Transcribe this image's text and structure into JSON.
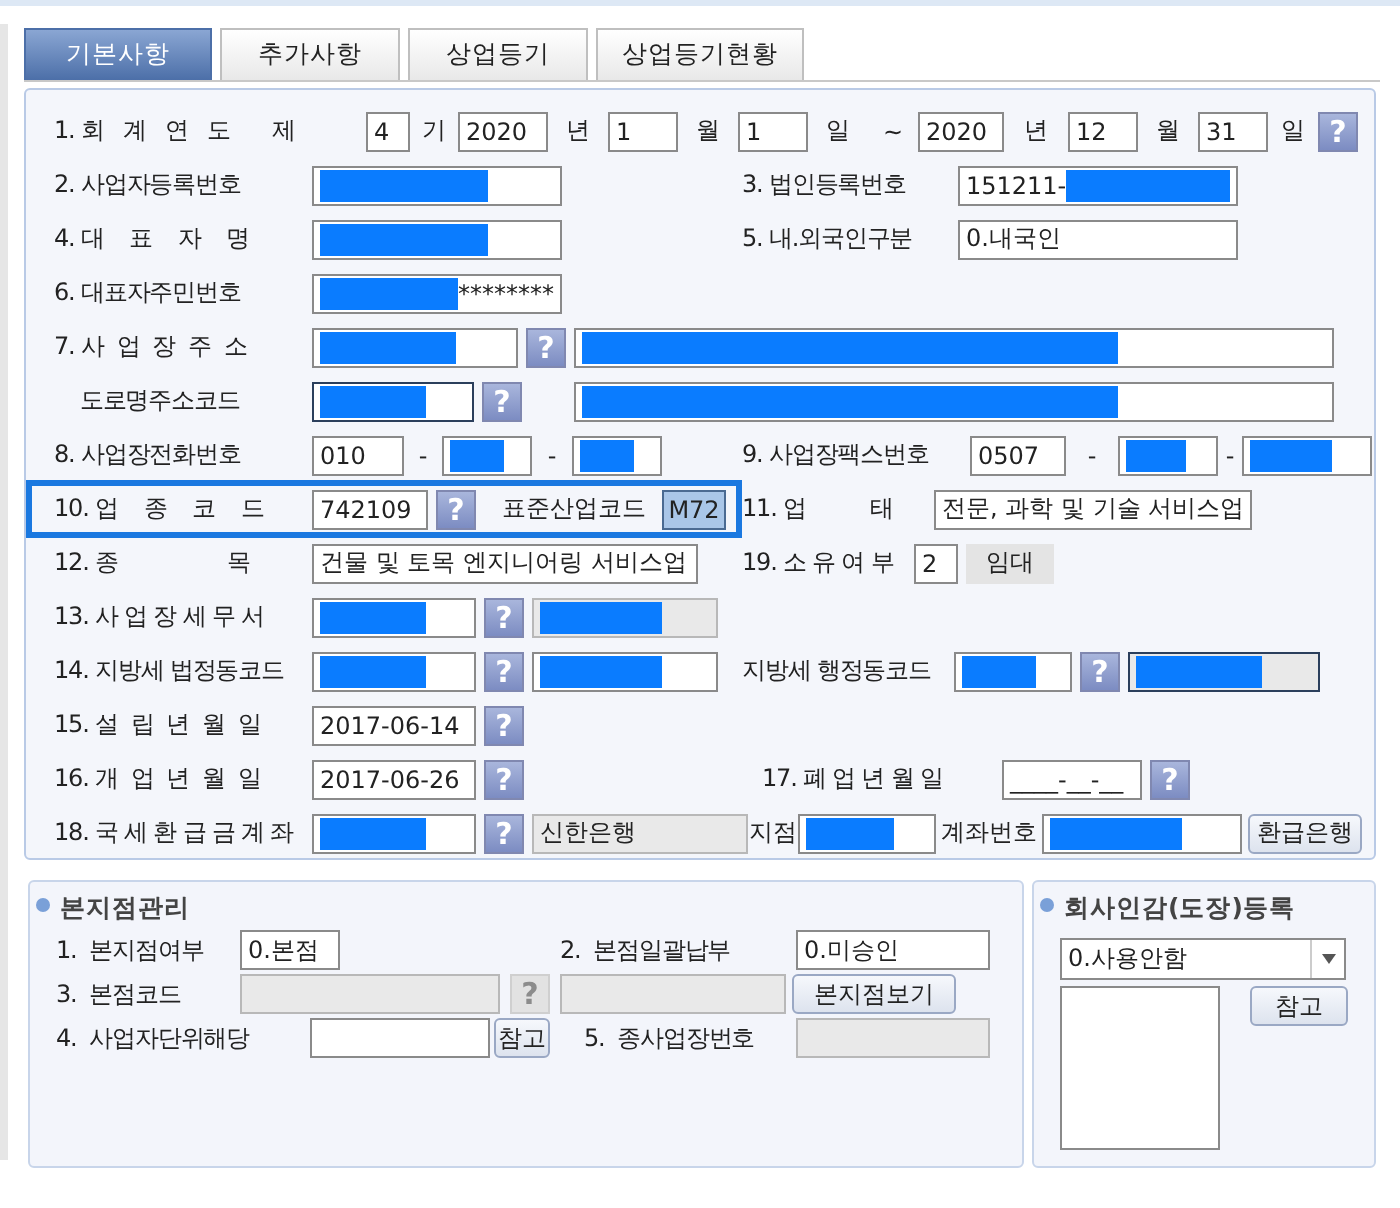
{
  "tabs": [
    {
      "label": "기본사항",
      "selected": true
    },
    {
      "label": "추가사항",
      "selected": false
    },
    {
      "label": "상업등기",
      "selected": false
    },
    {
      "label": "상업등기현황",
      "selected": false
    }
  ],
  "form": {
    "rows": [
      {
        "highlighted": false,
        "left": [
          {
            "kind": "label",
            "text": "1. 회   계   연   도"
          },
          {
            "kind": "text",
            "text": "제"
          },
          {
            "kind": "field",
            "value": "4",
            "redacted": false,
            "disabled": false,
            "focused": false
          },
          {
            "kind": "text",
            "text": "기"
          },
          {
            "kind": "field",
            "value": "2020",
            "redacted": false,
            "disabled": false,
            "focused": false
          },
          {
            "kind": "text",
            "text": "년"
          },
          {
            "kind": "field",
            "value": "1",
            "redacted": false,
            "disabled": false,
            "focused": false
          },
          {
            "kind": "text",
            "text": "월"
          },
          {
            "kind": "field",
            "value": "1",
            "redacted": false,
            "disabled": false,
            "focused": false
          },
          {
            "kind": "text",
            "text": "일"
          },
          {
            "kind": "text",
            "text": "~"
          },
          {
            "kind": "field",
            "value": "2020",
            "redacted": false,
            "disabled": false,
            "focused": false
          },
          {
            "kind": "text",
            "text": "년"
          },
          {
            "kind": "field",
            "value": "12",
            "redacted": false,
            "disabled": false,
            "focused": false
          },
          {
            "kind": "text",
            "text": "월"
          },
          {
            "kind": "field",
            "value": "31",
            "redacted": false,
            "disabled": false,
            "focused": false
          },
          {
            "kind": "text",
            "text": "일"
          },
          {
            "kind": "help",
            "text": "?",
            "disabled": false
          }
        ]
      },
      {
        "highlighted": false,
        "left": [
          {
            "kind": "label",
            "text": "2. 사업자등록번호"
          },
          {
            "kind": "field",
            "redacted": true,
            "disabled": false,
            "focused": false
          }
        ],
        "right": [
          {
            "kind": "label",
            "text": "3. 법인등록번호"
          },
          {
            "kind": "field",
            "value": "151211-",
            "redacted": true,
            "disabled": false,
            "focused": false
          }
        ]
      },
      {
        "highlighted": false,
        "left": [
          {
            "kind": "label",
            "text": "4. 대    표    자    명"
          },
          {
            "kind": "field",
            "redacted": true,
            "disabled": false,
            "focused": false
          }
        ],
        "right": [
          {
            "kind": "label",
            "text": "5. 내.외국인구분"
          },
          {
            "kind": "field",
            "value": "0.내국인",
            "redacted": false,
            "disabled": false,
            "focused": false
          }
        ]
      },
      {
        "highlighted": false,
        "left": [
          {
            "kind": "label",
            "text": "6. 대표자주민번호"
          },
          {
            "kind": "field",
            "redacted": true,
            "after": "********",
            "disabled": false,
            "focused": false
          }
        ]
      },
      {
        "highlighted": false,
        "left": [
          {
            "kind": "label",
            "text": "7. 사  업  장  주  소"
          },
          {
            "kind": "field",
            "redacted": true,
            "disabled": false,
            "focused": false
          },
          {
            "kind": "help",
            "text": "?",
            "disabled": false
          },
          {
            "kind": "field",
            "redacted": true,
            "disabled": false,
            "focused": false
          }
        ]
      },
      {
        "highlighted": false,
        "left": [
          {
            "kind": "label",
            "text": "    도로명주소코드"
          },
          {
            "kind": "field",
            "redacted": true,
            "disabled": false,
            "focused": true
          },
          {
            "kind": "help",
            "text": "?",
            "disabled": false
          },
          {
            "kind": "field",
            "redacted": true,
            "disabled": false,
            "focused": false
          }
        ]
      },
      {
        "highlighted": false,
        "left": [
          {
            "kind": "label",
            "text": "8. 사업장전화번호"
          },
          {
            "kind": "field",
            "value": "010",
            "redacted": false,
            "disabled": false,
            "focused": false
          },
          {
            "kind": "text",
            "text": "-"
          },
          {
            "kind": "field",
            "redacted": true,
            "disabled": false,
            "focused": false
          },
          {
            "kind": "text",
            "text": "-"
          },
          {
            "kind": "field",
            "redacted": true,
            "disabled": false,
            "focused": false
          }
        ],
        "right": [
          {
            "kind": "label",
            "text": "9. 사업장팩스번호"
          },
          {
            "kind": "field",
            "value": "0507",
            "redacted": false,
            "disabled": false,
            "focused": false
          },
          {
            "kind": "text",
            "text": "-"
          },
          {
            "kind": "field",
            "redacted": true,
            "disabled": false,
            "focused": false
          },
          {
            "kind": "text",
            "text": "-"
          },
          {
            "kind": "field",
            "redacted": true,
            "disabled": false,
            "focused": false
          }
        ]
      },
      {
        "highlighted": true,
        "left": [
          {
            "kind": "label",
            "text": "10. 업    종    코    드"
          },
          {
            "kind": "field",
            "value": "742109",
            "redacted": false,
            "disabled": false,
            "focused": false
          },
          {
            "kind": "help",
            "text": "?",
            "disabled": false
          },
          {
            "kind": "text",
            "text": "표준산업코드"
          },
          {
            "kind": "code",
            "text": "M72"
          }
        ],
        "right": [
          {
            "kind": "label",
            "text": "11. 업          태"
          },
          {
            "kind": "field",
            "value": "전문, 과학 및 기술 서비스업",
            "redacted": false,
            "disabled": false,
            "focused": false
          }
        ]
      },
      {
        "highlighted": false,
        "left": [
          {
            "kind": "label",
            "text": "12. 종                 목"
          },
          {
            "kind": "field",
            "value": "건물 및 토목 엔지니어링 서비스업",
            "redacted": false,
            "disabled": false,
            "focused": false
          }
        ],
        "right": [
          {
            "kind": "label",
            "text": "19. 소 유 여 부"
          },
          {
            "kind": "field",
            "value": "2",
            "redacted": false,
            "disabled": false,
            "focused": false
          },
          {
            "kind": "display",
            "text": "임대"
          }
        ]
      },
      {
        "highlighted": false,
        "left": [
          {
            "kind": "label",
            "text": "13. 사 업 장 세 무 서"
          },
          {
            "kind": "field",
            "redacted": true,
            "disabled": false,
            "focused": false
          },
          {
            "kind": "help",
            "text": "?",
            "disabled": false
          },
          {
            "kind": "field",
            "redacted": true,
            "disabled": true,
            "focused": false
          }
        ]
      },
      {
        "highlighted": false,
        "left": [
          {
            "kind": "label",
            "text": "14. 지방세 법정동코드"
          },
          {
            "kind": "field",
            "redacted": true,
            "disabled": false,
            "focused": false
          },
          {
            "kind": "help",
            "text": "?",
            "disabled": false
          },
          {
            "kind": "field",
            "redacted": true,
            "disabled": false,
            "focused": false
          }
        ],
        "right": [
          {
            "kind": "label",
            "text": "지방세 행정동코드"
          },
          {
            "kind": "field",
            "redacted": true,
            "disabled": false,
            "focused": false
          },
          {
            "kind": "help",
            "text": "?",
            "disabled": false
          },
          {
            "kind": "field",
            "redacted": true,
            "disabled": true,
            "focused": true
          }
        ]
      },
      {
        "highlighted": false,
        "left": [
          {
            "kind": "label",
            "text": "15. 설  립  년  월  일"
          },
          {
            "kind": "field",
            "value": "2017-06-14",
            "redacted": false,
            "disabled": false,
            "focused": false
          },
          {
            "kind": "help",
            "text": "?",
            "disabled": false
          }
        ]
      },
      {
        "highlighted": false,
        "left": [
          {
            "kind": "label",
            "text": "16. 개  업  년  월  일"
          },
          {
            "kind": "field",
            "value": "2017-06-26",
            "redacted": false,
            "disabled": false,
            "focused": false
          },
          {
            "kind": "help",
            "text": "?",
            "disabled": false
          }
        ],
        "right": [
          {
            "kind": "label",
            "text": "17. 폐 업 년 월 일"
          },
          {
            "kind": "field",
            "value": "____-__-__",
            "redacted": false,
            "disabled": false,
            "focused": false
          },
          {
            "kind": "help",
            "text": "?",
            "disabled": false
          }
        ]
      },
      {
        "highlighted": false,
        "left": [
          {
            "kind": "label",
            "text": "18. 국 세 환 급 금 계 좌"
          },
          {
            "kind": "field",
            "redacted": true,
            "disabled": false,
            "focused": false
          },
          {
            "kind": "help",
            "text": "?",
            "disabled": false
          },
          {
            "kind": "field",
            "value": "신한은행",
            "redacted": false,
            "disabled": true,
            "focused": false
          },
          {
            "kind": "text",
            "text": "지점"
          },
          {
            "kind": "field",
            "redacted": true,
            "disabled": false,
            "focused": false
          },
          {
            "kind": "text",
            "text": "계좌번호"
          },
          {
            "kind": "field",
            "redacted": true,
            "disabled": false,
            "focused": false
          },
          {
            "kind": "button",
            "text": "환급은행"
          }
        ]
      }
    ]
  },
  "branch": {
    "title": "본지점관리",
    "rows": [
      {
        "left": [
          {
            "kind": "label",
            "text": "1.  본지점여부"
          },
          {
            "kind": "field",
            "value": "0.본점",
            "redacted": false,
            "disabled": false,
            "focused": false
          }
        ],
        "right": [
          {
            "kind": "label",
            "text": "2.  본점일괄납부"
          },
          {
            "kind": "field",
            "value": "0.미승인",
            "redacted": false,
            "disabled": false,
            "focused": false
          }
        ]
      },
      {
        "left": [
          {
            "kind": "label",
            "text": "3.  본점코드"
          },
          {
            "kind": "field",
            "redacted": false,
            "disabled": true,
            "focused": false
          },
          {
            "kind": "help",
            "text": "?",
            "disabled": true
          }
        ],
        "right": [
          {
            "kind": "field",
            "redacted": false,
            "disabled": true,
            "focused": false
          },
          {
            "kind": "button",
            "text": "본지점보기"
          }
        ]
      },
      {
        "left": [
          {
            "kind": "label",
            "text": "4.  사업자단위해당"
          },
          {
            "kind": "field",
            "redacted": false,
            "disabled": false,
            "focused": false
          },
          {
            "kind": "button",
            "text": "참고"
          }
        ],
        "right": [
          {
            "kind": "label",
            "text": "5.  종사업장번호"
          },
          {
            "kind": "field",
            "redacted": false,
            "disabled": true,
            "focused": false
          }
        ]
      }
    ]
  },
  "seal": {
    "title": "회사인감(도장)등록",
    "select": {
      "value": "0.사용안함"
    },
    "button": "참고"
  }
}
